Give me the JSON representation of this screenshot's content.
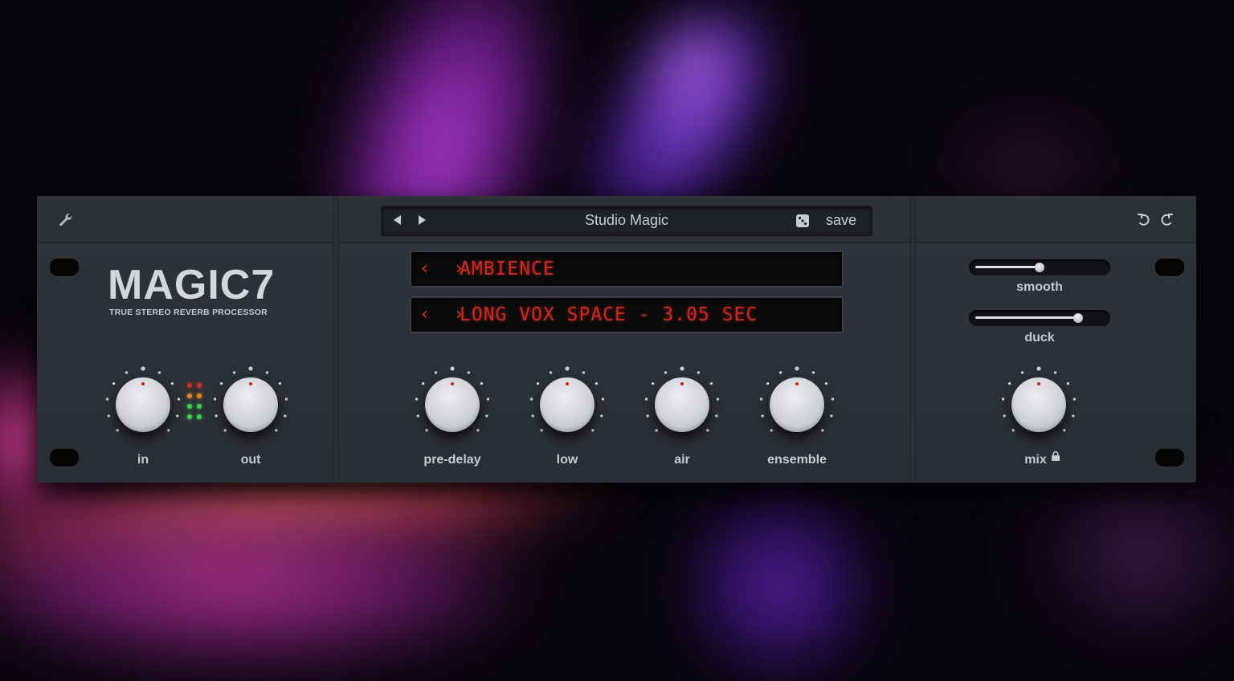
{
  "app": {
    "logo": "MAGIC7",
    "tagline": "TRUE STEREO REVERB PROCESSOR"
  },
  "header": {
    "preset_name": "Studio Magic",
    "save_label": "save",
    "icons": [
      "wrench-icon",
      "prev-preset-icon",
      "next-preset-icon",
      "dice-icon",
      "undo-icon",
      "redo-icon"
    ]
  },
  "displays": {
    "category_arrows": "‹ ›",
    "category": "AMBIENCE",
    "program_arrows": "‹ ›",
    "program": "LONG VOX SPACE - 3.05 SEC"
  },
  "knobs": {
    "in": "in",
    "out": "out",
    "pre_delay": "pre-delay",
    "low": "low",
    "air": "air",
    "ensemble": "ensemble",
    "mix": "mix"
  },
  "sliders": {
    "smooth": {
      "label": "smooth",
      "level": 0.5
    },
    "duck": {
      "label": "duck",
      "level": 0.8
    }
  },
  "meter": {
    "colors": [
      "#c8302a",
      "#c8302a",
      "#e08a2a",
      "#e08a2a",
      "#3fcf52",
      "#3fcf52",
      "#3fcf52",
      "#3fcf52"
    ]
  }
}
